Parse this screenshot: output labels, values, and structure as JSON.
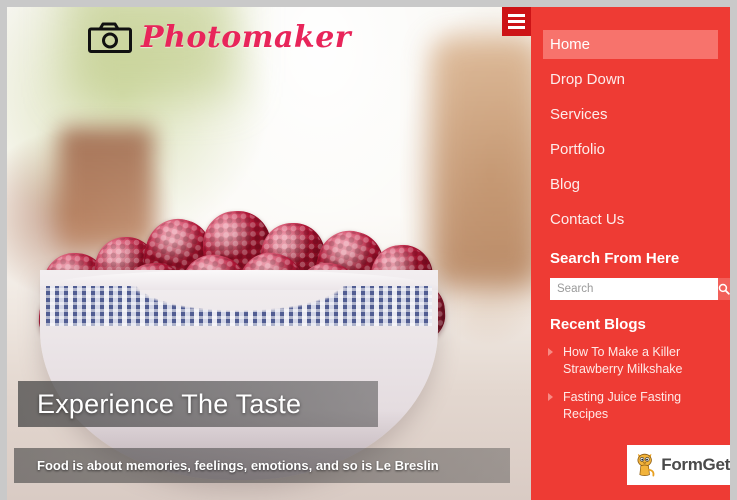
{
  "site": {
    "logo_text": "Photomaker",
    "logo_icon": "camera-icon"
  },
  "header": {
    "menu_toggle_label": "Menu"
  },
  "hero": {
    "title": "Experience The Taste",
    "subtitle": "Food is about memories, feelings, emotions, and so is Le Breslin",
    "image_alt": "bowl of raspberries"
  },
  "sidebar": {
    "nav_items": [
      {
        "label": "Home",
        "active": true
      },
      {
        "label": "Drop Down",
        "active": false
      },
      {
        "label": "Services",
        "active": false
      },
      {
        "label": "Portfolio",
        "active": false
      },
      {
        "label": "Blog",
        "active": false
      },
      {
        "label": "Contact Us",
        "active": false
      }
    ],
    "search": {
      "heading": "Search From Here",
      "placeholder": "Search",
      "value": "",
      "button_icon": "search-icon"
    },
    "recent": {
      "heading": "Recent Blogs",
      "items": [
        "How To Make a Killer Strawberry Milkshake",
        "Fasting Juice Fasting Recipes"
      ]
    }
  },
  "watermark": {
    "text": "FormGet",
    "icon": "cat-mascot-icon"
  },
  "colors": {
    "sidebar_red": "#ee3b34",
    "active_red": "#f7736c",
    "toggle_red": "#cd1316",
    "logo_pink": "#e8255a",
    "page_border_gray": "#c9c9c9"
  }
}
